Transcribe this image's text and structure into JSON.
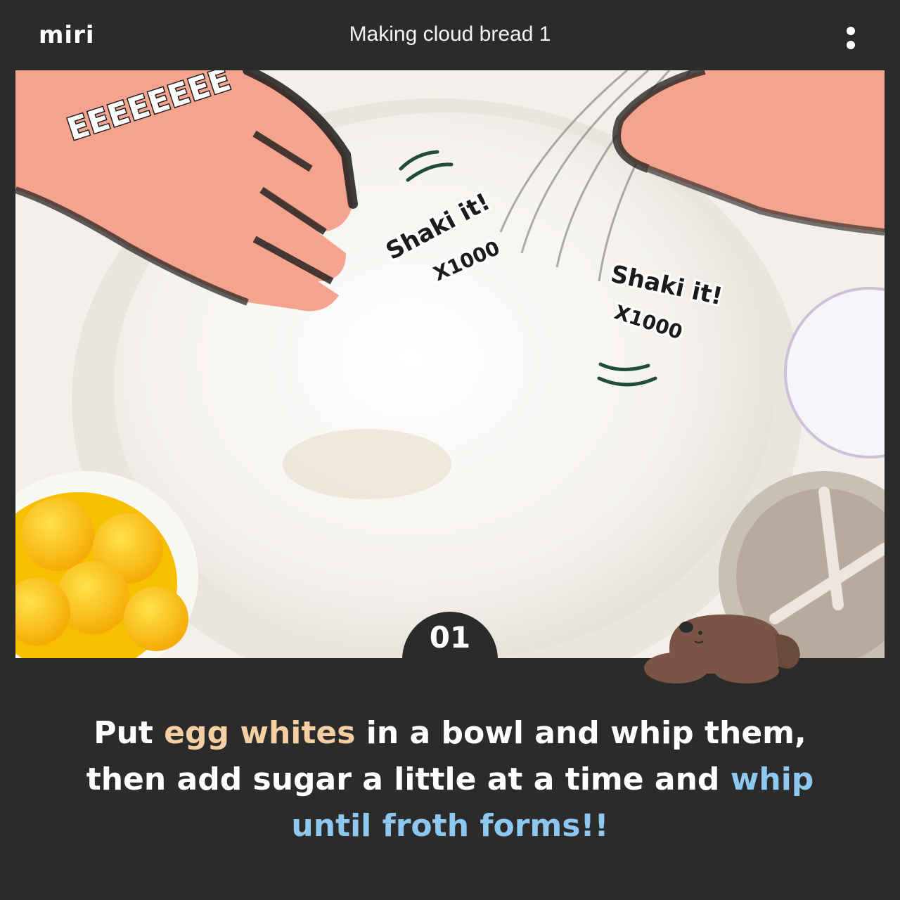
{
  "app": {
    "logo": "miri"
  },
  "header": {
    "title": "Making cloud bread 1"
  },
  "scene": {
    "sfx": "EEEEEEEE",
    "shake_text_1": "Shaki it!",
    "shake_count_1": "X1000",
    "shake_text_2": "Shaki it!",
    "shake_count_2": "X1000"
  },
  "step": {
    "number": "01"
  },
  "caption": {
    "part1": "Put ",
    "hl1": "egg whites",
    "part2": " in a bowl and whip them,",
    "part3": "then add sugar a little at a time and ",
    "hl2": "whip",
    "hl3": "until froth forms!!"
  },
  "colors": {
    "background": "#2b2b2b",
    "highlight_peach": "#f5cfa2",
    "highlight_blue": "#8ec8f0",
    "skin": "#f4a48e",
    "mascot": "#7a5546"
  }
}
